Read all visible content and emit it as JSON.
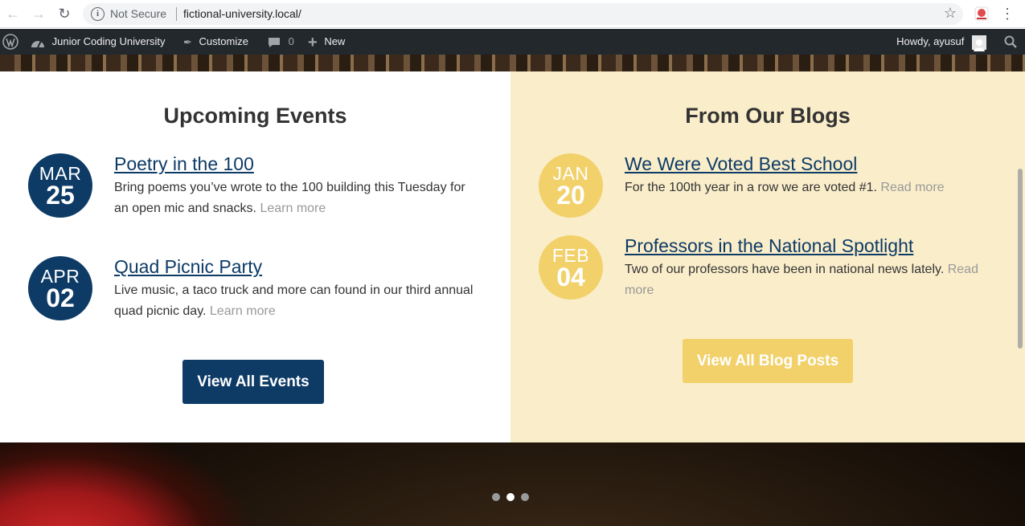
{
  "browser": {
    "security_label": "Not Secure",
    "url": "fictional-university.local/"
  },
  "adminbar": {
    "site_name": "Junior Coding University",
    "customize": "Customize",
    "comments_count": "0",
    "new_label": "New",
    "howdy": "Howdy, ayusuf"
  },
  "events": {
    "title": "Upcoming Events",
    "items": [
      {
        "month": "MAR",
        "day": "25",
        "title": "Poetry in the 100",
        "text": "Bring poems you’ve wrote to the 100 building this Tuesday for an open mic and snacks.",
        "link": "Learn more"
      },
      {
        "month": "APR",
        "day": "02",
        "title": "Quad Picnic Party",
        "text": "Live music, a taco truck and more can found in our third annual quad picnic day.",
        "link": "Learn more"
      }
    ],
    "button": "View All Events"
  },
  "blogs": {
    "title": "From Our Blogs",
    "items": [
      {
        "month": "JAN",
        "day": "20",
        "title": "We Were Voted Best School",
        "text": "For the 100th year in a row we are voted #1.",
        "link": "Read more"
      },
      {
        "month": "FEB",
        "day": "04",
        "title": "Professors in the National Spotlight",
        "text": "Two of our professors have been in national news lately.",
        "link": "Read more"
      }
    ],
    "button": "View All Blog Posts"
  },
  "colors": {
    "primary_blue": "#0d3b66",
    "accent_gold": "#f2d16b",
    "blog_bg": "#faedca",
    "adminbar_bg": "#23282d"
  },
  "slider": {
    "dots": 3,
    "active_index": 1
  }
}
